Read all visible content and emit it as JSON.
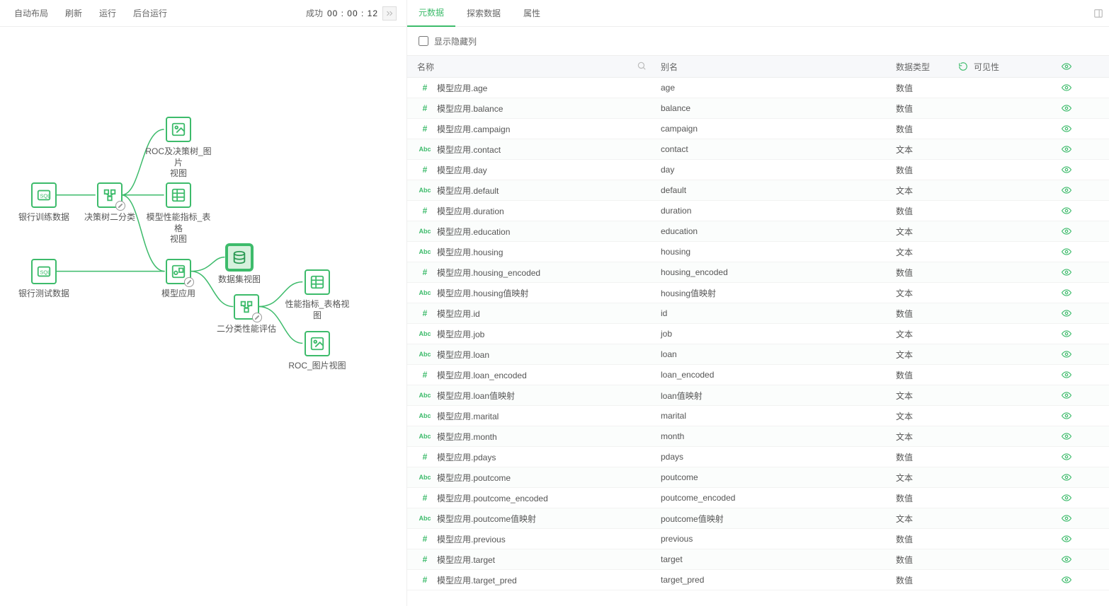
{
  "toolbar": {
    "autoLayout": "自动布局",
    "refresh": "刷新",
    "run": "运行",
    "backgroundRun": "后台运行",
    "statusLabel": "成功",
    "time": "00 : 00 : 12"
  },
  "tabs": {
    "meta": "元数据",
    "explore": "探索数据",
    "props": "属性"
  },
  "options": {
    "showHidden": "显示隐藏列"
  },
  "headers": {
    "name": "名称",
    "alias": "别名",
    "dataType": "数据类型",
    "visibility": "可见性"
  },
  "nodes": {
    "train": "银行训练数据",
    "test": "银行测试数据",
    "tree": "决策树二分类",
    "roc1": "ROC及决策树_图片\n视图",
    "perf1": "模型性能指标_表格\n视图",
    "apply": "模型应用",
    "dsview": "数据集视图",
    "eval": "二分类性能评估",
    "perf2": "性能指标_表格视图",
    "roc2": "ROC_图片视图"
  },
  "rows": [
    {
      "kind": "num",
      "name": "模型应用.age",
      "alias": "age",
      "dtype": "数值"
    },
    {
      "kind": "num",
      "name": "模型应用.balance",
      "alias": "balance",
      "dtype": "数值"
    },
    {
      "kind": "num",
      "name": "模型应用.campaign",
      "alias": "campaign",
      "dtype": "数值"
    },
    {
      "kind": "txt",
      "name": "模型应用.contact",
      "alias": "contact",
      "dtype": "文本"
    },
    {
      "kind": "num",
      "name": "模型应用.day",
      "alias": "day",
      "dtype": "数值"
    },
    {
      "kind": "txt",
      "name": "模型应用.default",
      "alias": "default",
      "dtype": "文本"
    },
    {
      "kind": "num",
      "name": "模型应用.duration",
      "alias": "duration",
      "dtype": "数值"
    },
    {
      "kind": "txt",
      "name": "模型应用.education",
      "alias": "education",
      "dtype": "文本"
    },
    {
      "kind": "txt",
      "name": "模型应用.housing",
      "alias": "housing",
      "dtype": "文本"
    },
    {
      "kind": "num",
      "name": "模型应用.housing_encoded",
      "alias": "housing_encoded",
      "dtype": "数值"
    },
    {
      "kind": "txt",
      "name": "模型应用.housing值映射",
      "alias": "housing值映射",
      "dtype": "文本"
    },
    {
      "kind": "num",
      "name": "模型应用.id",
      "alias": "id",
      "dtype": "数值"
    },
    {
      "kind": "txt",
      "name": "模型应用.job",
      "alias": "job",
      "dtype": "文本"
    },
    {
      "kind": "txt",
      "name": "模型应用.loan",
      "alias": "loan",
      "dtype": "文本"
    },
    {
      "kind": "num",
      "name": "模型应用.loan_encoded",
      "alias": "loan_encoded",
      "dtype": "数值"
    },
    {
      "kind": "txt",
      "name": "模型应用.loan值映射",
      "alias": "loan值映射",
      "dtype": "文本"
    },
    {
      "kind": "txt",
      "name": "模型应用.marital",
      "alias": "marital",
      "dtype": "文本"
    },
    {
      "kind": "txt",
      "name": "模型应用.month",
      "alias": "month",
      "dtype": "文本"
    },
    {
      "kind": "num",
      "name": "模型应用.pdays",
      "alias": "pdays",
      "dtype": "数值"
    },
    {
      "kind": "txt",
      "name": "模型应用.poutcome",
      "alias": "poutcome",
      "dtype": "文本"
    },
    {
      "kind": "num",
      "name": "模型应用.poutcome_encoded",
      "alias": "poutcome_encoded",
      "dtype": "数值"
    },
    {
      "kind": "txt",
      "name": "模型应用.poutcome值映射",
      "alias": "poutcome值映射",
      "dtype": "文本"
    },
    {
      "kind": "num",
      "name": "模型应用.previous",
      "alias": "previous",
      "dtype": "数值"
    },
    {
      "kind": "num",
      "name": "模型应用.target",
      "alias": "target",
      "dtype": "数值"
    },
    {
      "kind": "num",
      "name": "模型应用.target_pred",
      "alias": "target_pred",
      "dtype": "数值"
    }
  ]
}
